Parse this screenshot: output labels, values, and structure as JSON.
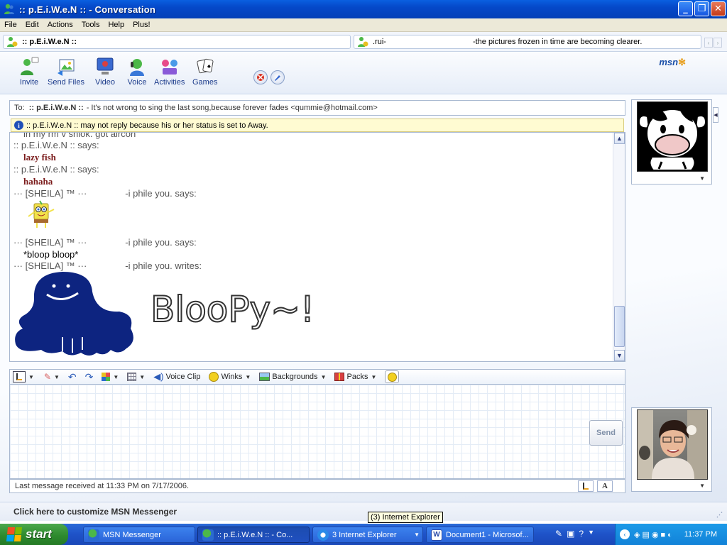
{
  "window": {
    "title": ":: p.E.i.W.e.N :: - Conversation",
    "buttons": {
      "minimize": "_",
      "maximize": "❐",
      "close": "✕"
    }
  },
  "menu": [
    "File",
    "Edit",
    "Actions",
    "Tools",
    "Help",
    "Plus!"
  ],
  "contacts": {
    "primary": ":: p.E.i.W.e.N ::",
    "secondary_name": ".rui-",
    "secondary_message": "-the pictures frozen in time are becoming clearer."
  },
  "toolbar": {
    "invite": "Invite",
    "send_files": "Send Files",
    "video": "Video",
    "voice": "Voice",
    "activities": "Activities",
    "games": "Games",
    "logo": "msn"
  },
  "to_bar": {
    "label": "To:",
    "name": ":: p.E.i.W.e.N ::",
    "message": "- It's not wrong to sing the last song,because forever fades <qummie@hotmail.com>"
  },
  "notice": {
    "icon": "i",
    "text": ":: p.E.i.W.e.N :: may not reply because his or her status is set to Away."
  },
  "history": {
    "partial_line": "in my rm v shiok. got aircon",
    "line1_sender": ":: p.E.i.W.e.N :: says:",
    "line1_msg": "lazy fish",
    "line2_sender": ":: p.E.i.W.e.N :: says:",
    "line2_msg": "hahaha",
    "line3_sender": "··· [SHEILA] ™ ···",
    "line3_tail": "-i phile you.  says:",
    "line4_sender": "··· [SHEILA] ™ ···",
    "line4_tail": "-i phile you.  says:",
    "line4_msg": "*bloop bloop*",
    "line5_sender": "··· [SHEILA] ™ ···",
    "line5_tail": "-i phile you.  writes:",
    "drawing_text": "BlooPy~!"
  },
  "compose_toolbar": {
    "voice_clip": "Voice Clip",
    "winks": "Winks",
    "backgrounds": "Backgrounds",
    "packs": "Packs"
  },
  "send_label": "Send",
  "status": "Last message received at 11:33 PM on 7/17/2006.",
  "text_mode_label": "A",
  "customize": "Click here to customize MSN Messenger",
  "tooltip": "(3) Internet Explorer",
  "taskbar": {
    "start": "start",
    "tasks": [
      "MSN Messenger",
      ":: p.E.i.W.e.N :: - Co...",
      "3 Internet Explorer",
      "Document1 - Microsof..."
    ],
    "clock": "11:37 PM"
  },
  "colors": {
    "accent": "#0548c8",
    "ink_blue": "#0d2480",
    "start_green": "#2e8a2e"
  }
}
